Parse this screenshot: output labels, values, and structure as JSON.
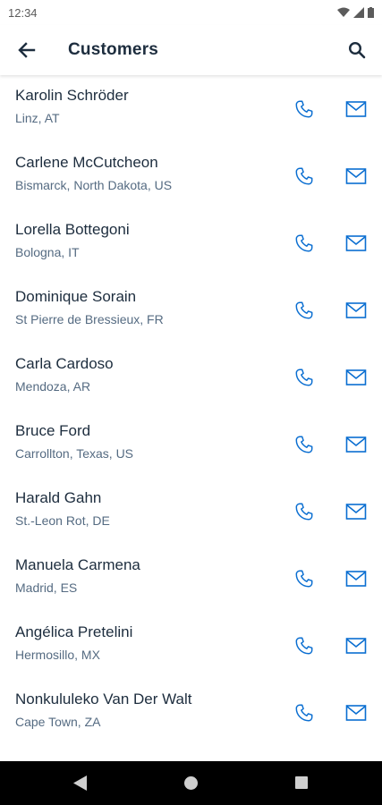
{
  "status_bar": {
    "time": "12:34"
  },
  "app_bar": {
    "title": "Customers"
  },
  "icons": {
    "back": "arrow-left",
    "search": "magnifier",
    "phone": "phone-handset",
    "mail": "envelope"
  },
  "colors": {
    "accent": "#0a6ed1",
    "text": "#1d2d3e",
    "subtext": "#556b82"
  },
  "customers": [
    {
      "name": "Karolin Schröder",
      "location": "Linz, AT"
    },
    {
      "name": "Carlene McCutcheon",
      "location": "Bismarck, North Dakota, US"
    },
    {
      "name": "Lorella Bottegoni",
      "location": "Bologna, IT"
    },
    {
      "name": "Dominique Sorain",
      "location": "St Pierre de Bressieux, FR"
    },
    {
      "name": "Carla Cardoso",
      "location": "Mendoza, AR"
    },
    {
      "name": "Bruce Ford",
      "location": "Carrollton, Texas, US"
    },
    {
      "name": "Harald Gahn",
      "location": "St.-Leon Rot, DE"
    },
    {
      "name": "Manuela Carmena",
      "location": "Madrid, ES"
    },
    {
      "name": "Angélica Pretelini",
      "location": "Hermosillo, MX"
    },
    {
      "name": "Nonkululeko Van Der Walt",
      "location": "Cape Town, ZA"
    }
  ]
}
